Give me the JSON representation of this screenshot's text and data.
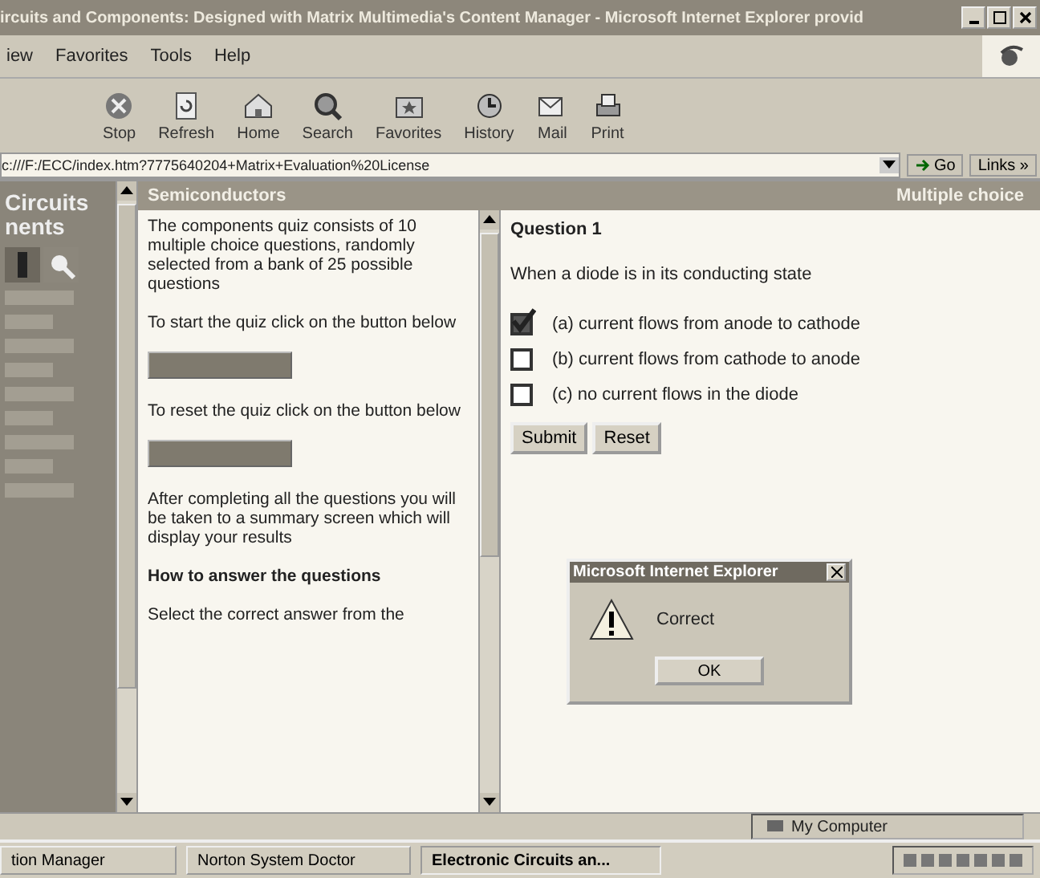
{
  "window": {
    "title": "ircuits and Components: Designed with Matrix Multimedia's Content Manager - Microsoft Internet Explorer provid"
  },
  "menu": [
    "iew",
    "Favorites",
    "Tools",
    "Help"
  ],
  "toolbar": [
    {
      "label": "Stop",
      "kind": "stop"
    },
    {
      "label": "Refresh",
      "kind": "refresh"
    },
    {
      "label": "Home",
      "kind": "home"
    },
    {
      "label": "Search",
      "kind": "search"
    },
    {
      "label": "Favorites",
      "kind": "favorites"
    },
    {
      "label": "History",
      "kind": "history"
    },
    {
      "label": "Mail",
      "kind": "mail"
    },
    {
      "label": "Print",
      "kind": "print"
    }
  ],
  "address": {
    "value": "c:///F:/ECC/index.htm?7775640204+Matrix+Evaluation%20License",
    "go": "Go",
    "links": "Links »"
  },
  "sidebar": {
    "title": [
      "Circuits",
      "nents"
    ]
  },
  "left_pane": {
    "header": "Semiconductors",
    "paragraphs": [
      {
        "kind": "text",
        "text": "The components quiz consists of 10 multiple choice questions, randomly selected from a bank of 25 possible questions"
      },
      {
        "kind": "text",
        "text": "To start the quiz click on the button below"
      },
      {
        "kind": "button"
      },
      {
        "kind": "text",
        "text": "To reset the quiz click on the button below"
      },
      {
        "kind": "button"
      },
      {
        "kind": "text",
        "text": "After completing all the questions you will be taken to a summary screen which will display your results"
      },
      {
        "kind": "heading",
        "text": "How to answer the questions"
      },
      {
        "kind": "text",
        "text": "Select the correct answer from the"
      }
    ]
  },
  "right_pane": {
    "header": "Multiple choice",
    "question_title": "Question 1",
    "question": "When a diode is in its conducting state",
    "options": [
      {
        "label": "(a) current flows from anode to cathode",
        "checked": true
      },
      {
        "label": "(b) current flows from cathode to anode",
        "checked": false
      },
      {
        "label": "(c) no current flows in the diode",
        "checked": false
      }
    ],
    "buttons": [
      "Submit",
      "Reset"
    ]
  },
  "dialog": {
    "title": "Microsoft Internet Explorer",
    "message": "Correct",
    "button": "OK"
  },
  "status_bar": {
    "zone": "My Computer"
  },
  "taskbar": [
    "tion Manager",
    "Norton System Doctor",
    "Electronic Circuits an..."
  ]
}
